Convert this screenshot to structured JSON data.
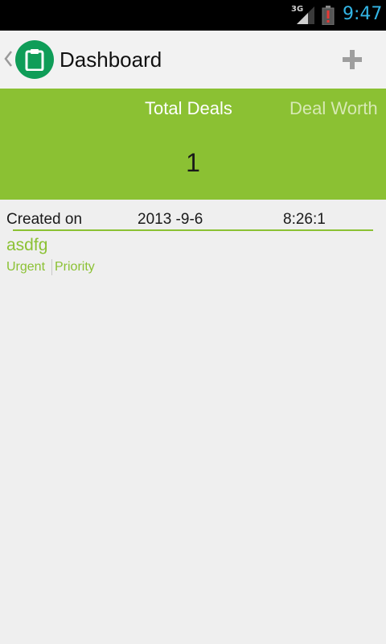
{
  "status_bar": {
    "network": "3G",
    "time": "9:47"
  },
  "action_bar": {
    "title": "Dashboard",
    "app_icon": "clipboard-icon",
    "action_icon": "plus-icon"
  },
  "banner": {
    "tabs": [
      {
        "label": "Total Deals"
      },
      {
        "label": "Deal Worth"
      }
    ],
    "value": "1"
  },
  "deals": [
    {
      "created_label": "Created on",
      "date": "2013 -9-6",
      "time": "8:26:1",
      "name": "asdfg",
      "urgency": "Urgent",
      "priority": "Priority"
    }
  ],
  "colors": {
    "accent": "#8bc133",
    "app_icon_bg": "#0f9d58",
    "clock": "#33b5e5",
    "battery_alert": "#e53935"
  }
}
